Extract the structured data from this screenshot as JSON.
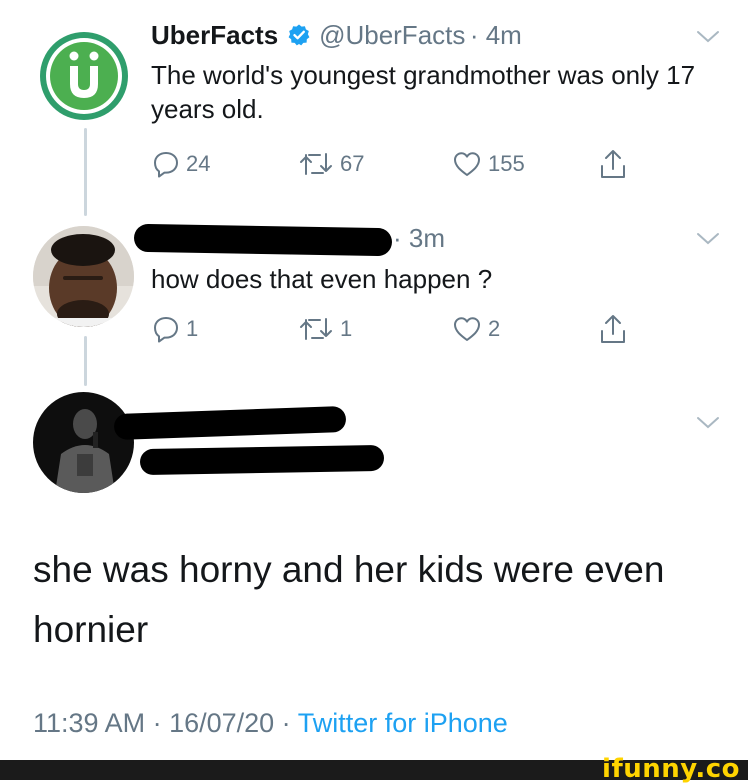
{
  "tweets": [
    {
      "name": "UberFacts",
      "handle": "@UberFacts",
      "time": "· 4m",
      "text": "The world's youngest grandmother was only 17 years old.",
      "replies": "24",
      "retweets": "67",
      "likes": "155"
    },
    {
      "time": "· 3m",
      "text": "how does that even happen ?",
      "replies": "1",
      "retweets": "1",
      "likes": "2"
    }
  ],
  "focused_tweet": {
    "text": "she was horny and her kids were even hornier",
    "timestamp": "11:39 AM · 16/07/20 ·",
    "source": "Twitter for iPhone"
  },
  "watermark": "ifunny.co",
  "colors": {
    "uberfacts_green": "#5cb85c",
    "verified_blue": "#1da1f2",
    "gray_text": "#657786",
    "link_blue": "#1da1f2"
  },
  "icons": [
    "reply-icon",
    "retweet-icon",
    "like-icon",
    "share-icon",
    "chevron-down-icon",
    "verified-badge-icon"
  ]
}
